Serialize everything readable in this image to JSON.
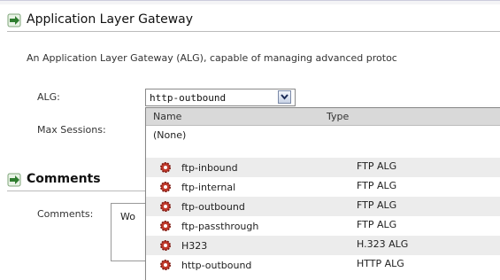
{
  "alg_section": {
    "title": "Application Layer Gateway",
    "description": "An Application Layer Gateway (ALG), capable of managing advanced protoc",
    "alg_label": "ALG:",
    "alg_value": "http-outbound",
    "max_sessions_label": "Max Sessions:"
  },
  "comments_section": {
    "title": "Comments",
    "comments_label": "Comments:",
    "comments_value": "Wo"
  },
  "dropdown": {
    "headers": {
      "name": "Name",
      "type": "Type"
    },
    "none_option": "(None)",
    "options": [
      {
        "name": "ftp-inbound",
        "type": "FTP ALG"
      },
      {
        "name": "ftp-internal",
        "type": "FTP ALG"
      },
      {
        "name": "ftp-outbound",
        "type": "FTP ALG"
      },
      {
        "name": "ftp-passthrough",
        "type": "FTP ALG"
      },
      {
        "name": "H323",
        "type": "H.323 ALG"
      },
      {
        "name": "http-outbound",
        "type": "HTTP ALG"
      }
    ]
  },
  "colors": {
    "section_arrow": "#2f7d2f",
    "alg_gear": "#c0392b",
    "alt_row": "#ececec"
  },
  "icons": {
    "section": "green-arrow-icon",
    "option": "gear-icon",
    "dropdown": "chevron-down-icon"
  }
}
